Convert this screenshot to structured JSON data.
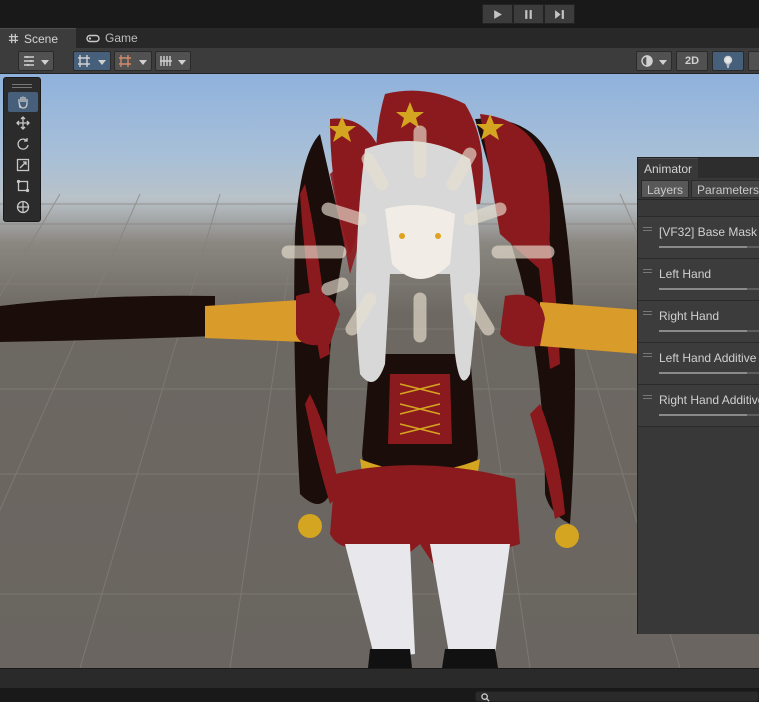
{
  "play_controls": {
    "play_icon": "play-icon",
    "pause_icon": "pause-icon",
    "step_icon": "step-icon"
  },
  "tabs": [
    {
      "label": "Scene",
      "icon": "grid-icon"
    },
    {
      "label": "Game",
      "icon": "gamepad-icon"
    }
  ],
  "toolbar": {
    "left_buttons": [
      "draw-mode-icon",
      "gizmo-toggle-icon",
      "snap-icon",
      "grid-snap-icon"
    ],
    "right_buttons": [
      "shading-mode-icon",
      "2D",
      "lighting-icon"
    ],
    "mode_2d_label": "2D"
  },
  "tool_palette": [
    "hand-icon",
    "move-icon",
    "rotate-icon",
    "scale-icon",
    "rect-icon",
    "transform-icon"
  ],
  "animator": {
    "title": "Animator",
    "tabs": [
      "Layers",
      "Parameters"
    ],
    "layers": [
      {
        "name": "[VF32] Base Mask",
        "weight": 0.8
      },
      {
        "name": "Left Hand",
        "weight": 0.8
      },
      {
        "name": "Right Hand",
        "weight": 0.8
      },
      {
        "name": "Left Hand Additive",
        "weight": 0.8
      },
      {
        "name": "Right Hand Additive",
        "weight": 0.8
      }
    ]
  },
  "colors": {
    "accent": "#46607c",
    "panel": "#383838",
    "toolbar": "#3c3c3c"
  }
}
